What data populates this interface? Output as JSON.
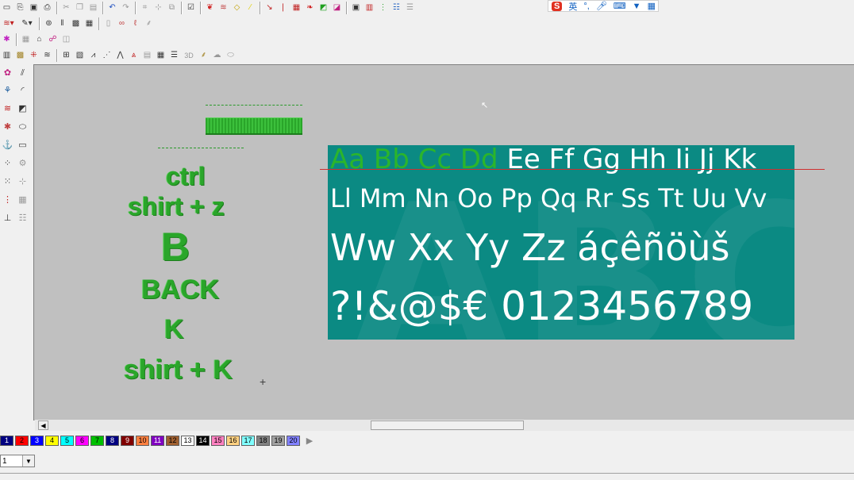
{
  "ime": {
    "logo": "S",
    "mode": "英",
    "icons": [
      "punctuation-icon",
      "microphone-icon",
      "keyboard-icon",
      "skin-icon",
      "apps-icon"
    ]
  },
  "toolbar_row1": [
    "new-icon",
    "open-icon",
    "save-icon",
    "cut-icon",
    "copy-icon",
    "paste-icon",
    "print-icon",
    "undo-icon",
    "redo-icon",
    "snap-icon",
    "node-icon",
    "mirror-icon",
    "check-icon",
    "red-leaf-icon",
    "pattern-icon",
    "shape-icon",
    "needle-icon",
    "grid-icon",
    "red-feather-icon",
    "chart-icon",
    "image-icon",
    "card-icon",
    "color-list-icon",
    "stitch-list-icon"
  ],
  "toolbar_row2": [
    "stitch-type-icon",
    "pen-icon",
    "satin-icon",
    "column-icon",
    "fill-icon",
    "motif-icon",
    "applique-icon",
    "chain-icon",
    "loop-icon",
    "hand-stitch-icon"
  ],
  "toolbar_row3": [
    "pink-bug-icon",
    "grid-select-icon",
    "house-icon",
    "people-icon",
    "split-icon"
  ],
  "toolbar_row4": [
    "tatami-icon",
    "weave-icon",
    "cross-icon",
    "wave-icon",
    "net-icon",
    "hatch-icon",
    "zigzag-icon",
    "radial-icon",
    "spike-icon",
    "ribbon-icon",
    "texture-icon",
    "tile-icon",
    "lines-icon",
    "three-d-label",
    "feather-icon",
    "cloud-icon",
    "oval-icon"
  ],
  "three_d_label": "3D",
  "sidebar": [
    "flower-icon",
    "diagonal-lines-icon",
    "embroidery-icon",
    "arc-icon",
    "stitch-red-icon",
    "edit-shape-icon",
    "bug-icon",
    "ellipse-icon",
    "anchor-icon",
    "rectangle-icon",
    "dots-icon",
    "gear-icon",
    "chain-dots-icon",
    "transform-icon",
    "run-icon",
    "grid-edit-icon",
    "level-icon",
    "list-icon"
  ],
  "embroidery_text": {
    "line1": "ctrl",
    "line2": "shirt  +  z",
    "line3": "B",
    "line4": "BACK",
    "line5": "K",
    "line6": "shirt  +  K"
  },
  "font_preview": {
    "row1_green": "Aa Bb Cc Dd",
    "row1_white": "Ee Ff Gg Hh Ii Jj Kk",
    "row2": "Ll Mm Nn Oo Pp Qq Rr Ss Tt Uu Vv",
    "row3": "Ww Xx Yy Zz áçêñöùš",
    "row4": "?!&@$€ 0123456789",
    "bg_color": "#0b8a83",
    "highlight_color": "#2bb52b"
  },
  "palette": {
    "swatches": [
      {
        "label": "1",
        "color": "#000080"
      },
      {
        "label": "2",
        "color": "#ff0000"
      },
      {
        "label": "3",
        "color": "#0000ff"
      },
      {
        "label": "4",
        "color": "#ffff00"
      },
      {
        "label": "5",
        "color": "#00ffff"
      },
      {
        "label": "6",
        "color": "#ff00ff"
      },
      {
        "label": "7",
        "color": "#00c000"
      },
      {
        "label": "8",
        "color": "#000080"
      },
      {
        "label": "9",
        "color": "#800000"
      },
      {
        "label": "10",
        "color": "#ff8040"
      },
      {
        "label": "11",
        "color": "#8000c0"
      },
      {
        "label": "12",
        "color": "#a06030"
      },
      {
        "label": "13",
        "color": "#ffffff"
      },
      {
        "label": "14",
        "color": "#000000"
      },
      {
        "label": "15",
        "color": "#ff80c0"
      },
      {
        "label": "16",
        "color": "#ffd080"
      },
      {
        "label": "17",
        "color": "#80ffff"
      },
      {
        "label": "18",
        "color": "#808080"
      },
      {
        "label": "19",
        "color": "#a0a0a0"
      },
      {
        "label": "20",
        "color": "#8080ff"
      }
    ]
  },
  "combo": {
    "value": "1"
  }
}
